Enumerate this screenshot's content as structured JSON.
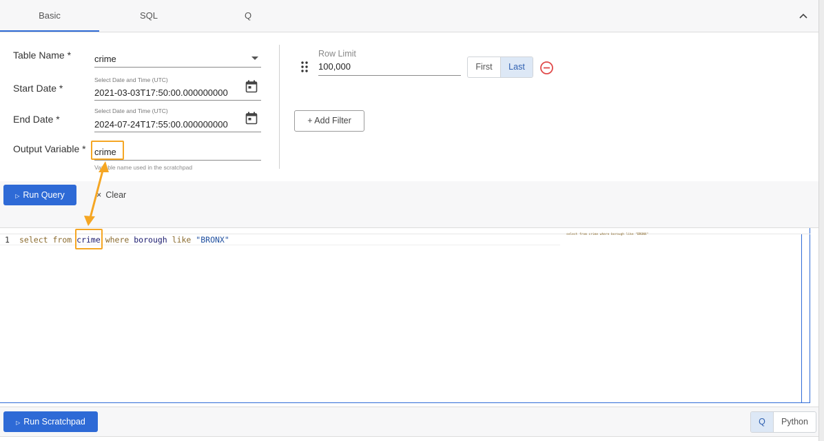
{
  "tabs": [
    {
      "label": "Basic",
      "active": true
    },
    {
      "label": "SQL",
      "active": false
    },
    {
      "label": "Q",
      "active": false
    }
  ],
  "form": {
    "table_name": {
      "label": "Table Name *",
      "value": "crime"
    },
    "start_date": {
      "label": "Start Date *",
      "hint": "Select Date and Time (UTC)",
      "value": "2021-03-03T17:50:00.000000000"
    },
    "end_date": {
      "label": "End Date *",
      "hint": "Select Date and Time (UTC)",
      "value": "2024-07-24T17:55:00.000000000"
    },
    "output_variable": {
      "label": "Output Variable *",
      "value": "crime",
      "helper": "Variable name used in the scratchpad"
    }
  },
  "row_limit": {
    "label": "Row Limit",
    "value": "100,000",
    "options": [
      "First",
      "Last"
    ],
    "selected": "Last"
  },
  "add_filter_label": "+ Add Filter",
  "actions": {
    "run_query": "Run Query",
    "clear": "Clear"
  },
  "editor": {
    "line_number": "1",
    "tokens": {
      "select": "select",
      "from": "from",
      "table": "crime",
      "where": "where",
      "column": "borough",
      "like": "like",
      "string": "\"BRONX\""
    },
    "minimap_text": "select from crime where borough like \"BRONX\""
  },
  "bottom": {
    "run_scratchpad": "Run Scratchpad",
    "languages": [
      "Q",
      "Python"
    ],
    "selected_language": "Q"
  },
  "colors": {
    "accent": "#2e6ad6",
    "annotation": "#f5a623",
    "remove": "#e04848"
  }
}
